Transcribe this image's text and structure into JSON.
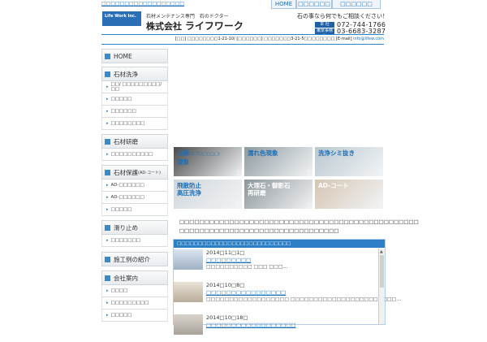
{
  "header": {
    "tagline": "□□□□□□□□□□□□□□□□□□",
    "logo_text": "Life Work Inc.",
    "company_sub": "石材メンテナンス専門　石のドクター",
    "company_prefix": "株式会社",
    "company_name": "ライフワーク",
    "nav": {
      "home": "HOME",
      "item2": "□□□□□□",
      "item3": "□□□□□□"
    },
    "consult": "石の事なら何でもご相談ください！",
    "tel1_badge": "本 社",
    "tel1": "072-744-1766",
    "tel2_badge": "東京事務所",
    "tel2": "03-6683-3287",
    "address": "[□□] □□□□□□□□1-21-10/ [□□□□□□] □□□□□□□3-21-5□□□□□□□□ [E-mail]",
    "email": "info@lifew.com"
  },
  "sidebar": {
    "home": "HOME",
    "sections": [
      {
        "title": "石材洗浄",
        "items": [
          "□□/ □□□□□□□□□/□□",
          "□□□□□",
          "□□□□□□",
          "□□□□□□□□"
        ]
      },
      {
        "title": "石材研磨",
        "items": [
          "□□□□□□□□□□"
        ]
      },
      {
        "title": "石材保護",
        "title_small": "(AD-コート)",
        "items": [
          "AD-□□□□□□",
          "AD-□□□□□□",
          "□□□□□"
        ]
      },
      {
        "title": "滑り止め",
        "items": [
          "□□□□□□□"
        ]
      },
      {
        "title": "施工例の紹介",
        "items": []
      },
      {
        "title": "会社案内",
        "items": [
          "□□□□",
          "□□□□□□□□□",
          "□□□□□"
        ]
      }
    ]
  },
  "tiles": [
    {
      "line1": "白華",
      "line1_small": "(エフロ□□□□)",
      "line2": "現象",
      "bg": "#4a4a4a"
    },
    {
      "line1": "濡れ色現象",
      "line2": "",
      "bg": "#8e9aa0"
    },
    {
      "line1": "洗浄シミ抜き",
      "line2": "",
      "bg": "#b9c8cf"
    },
    {
      "line1": "飛散防止",
      "line2": "高圧洗浄",
      "bg": "#cfd6db"
    },
    {
      "line1": "大理石・御影石",
      "line2": "再研磨",
      "bg": "#8c959a"
    },
    {
      "line1": "AD-コート",
      "line2": "",
      "bg": "#d4c5b1"
    }
  ],
  "intro": [
    "□□□□□□□□□□□□□□□□□□□□□□□□□□□□□□□□□□□□□□□□□□□□□□□□",
    "□□□□□□□□□□□□□□□□□□□□□□□□□□□□□□□□"
  ],
  "news": {
    "heading": "□□□□□□□□□□□□□□□□□□□□□□□□□□□",
    "entries": [
      {
        "date": "2014□11□1□",
        "title": "□□□□□□□□□",
        "desc": "□□□□□□□□□□ □□□ □□□…"
      },
      {
        "date": "2014□10□8□",
        "title": "□□□□□□□□□□□□□□□□",
        "desc": "□□□□□□□□□□□□□□□□□□ □□□□□□□□□□□□□□□□□□□□□□□…"
      },
      {
        "date": "2014□10□18□",
        "title": "□□□□□□□□□□□□□□□□□□",
        "desc": ""
      }
    ]
  }
}
